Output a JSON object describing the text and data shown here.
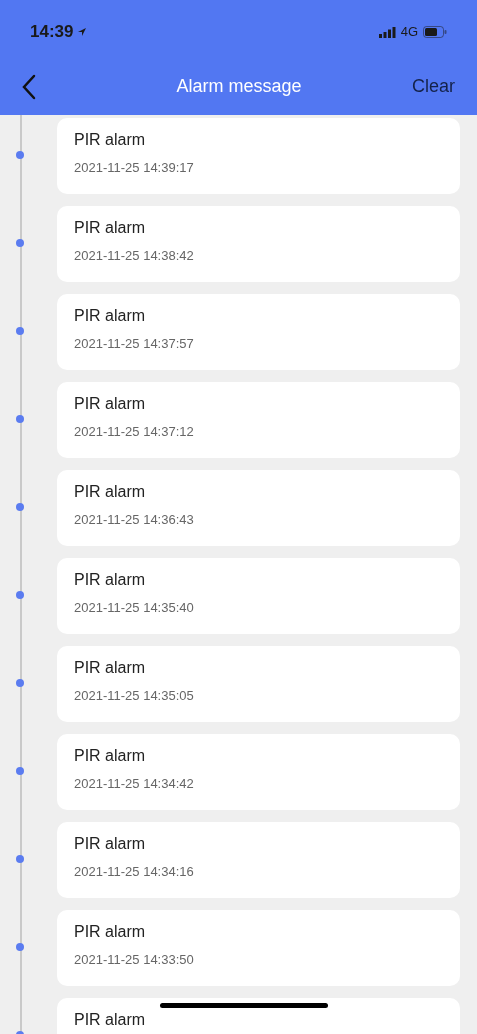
{
  "status_bar": {
    "time": "14:39",
    "network": "4G"
  },
  "nav": {
    "title": "Alarm message",
    "action": "Clear"
  },
  "alarms": [
    {
      "title": "PIR alarm",
      "time": "2021-11-25 14:39:17"
    },
    {
      "title": "PIR alarm",
      "time": "2021-11-25 14:38:42"
    },
    {
      "title": "PIR alarm",
      "time": "2021-11-25 14:37:57"
    },
    {
      "title": "PIR alarm",
      "time": "2021-11-25 14:37:12"
    },
    {
      "title": "PIR alarm",
      "time": "2021-11-25 14:36:43"
    },
    {
      "title": "PIR alarm",
      "time": "2021-11-25 14:35:40"
    },
    {
      "title": "PIR alarm",
      "time": "2021-11-25 14:35:05"
    },
    {
      "title": "PIR alarm",
      "time": "2021-11-25 14:34:42"
    },
    {
      "title": "PIR alarm",
      "time": "2021-11-25 14:34:16"
    },
    {
      "title": "PIR alarm",
      "time": "2021-11-25 14:33:50"
    },
    {
      "title": "PIR alarm"
    }
  ]
}
